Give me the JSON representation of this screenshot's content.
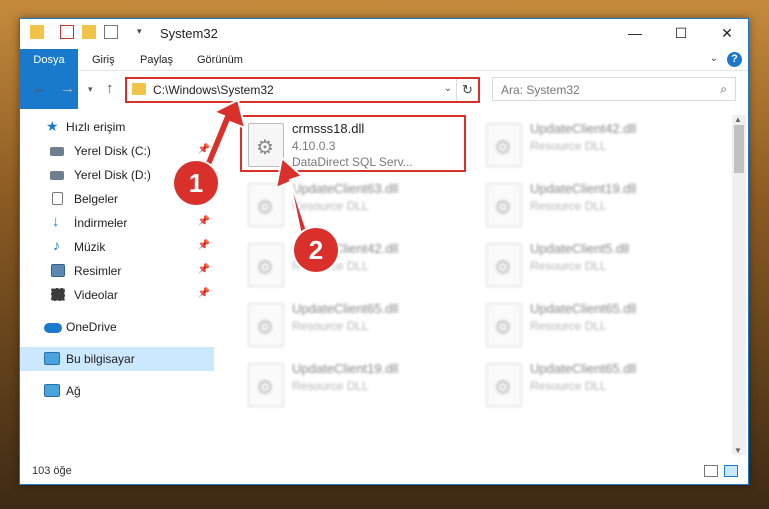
{
  "window": {
    "title": "System32",
    "controls": {
      "minimize": "—",
      "maximize": "☐",
      "close": "✕"
    }
  },
  "ribbon": {
    "tabs": [
      "Dosya",
      "Giriş",
      "Paylaş",
      "Görünüm"
    ],
    "help": "?"
  },
  "nav": {
    "address": "C:\\Windows\\System32",
    "search_placeholder": "Ara: System32"
  },
  "sidebar": {
    "items": [
      {
        "label": "Hızlı erişim",
        "icon": "star-icon"
      },
      {
        "label": "Yerel Disk (C:)",
        "icon": "drive-icon"
      },
      {
        "label": "Yerel Disk (D:)",
        "icon": "drive-icon"
      },
      {
        "label": "Belgeler",
        "icon": "documents-icon"
      },
      {
        "label": "İndirmeler",
        "icon": "download-icon"
      },
      {
        "label": "Müzik",
        "icon": "music-icon"
      },
      {
        "label": "Resimler",
        "icon": "pictures-icon"
      },
      {
        "label": "Videolar",
        "icon": "video-icon"
      },
      {
        "label": "OneDrive",
        "icon": "cloud-icon"
      },
      {
        "label": "Bu bilgisayar",
        "icon": "computer-icon"
      },
      {
        "label": "Ağ",
        "icon": "network-icon"
      }
    ]
  },
  "files": [
    {
      "name": "crmsss18.dll",
      "line2": "4.10.0.3",
      "line3": "DataDirect SQL Serv..."
    },
    {
      "name": "UpdateClient42.dll",
      "line2": "Resource DLL"
    },
    {
      "name": "UpdateClient63.dll",
      "line2": "Resource DLL"
    },
    {
      "name": "UpdateClient19.dll",
      "line2": "Resource DLL"
    },
    {
      "name": "UpdateClient42.dll",
      "line2": "Resource DLL"
    },
    {
      "name": "UpdateClient5.dll",
      "line2": "Resource DLL"
    },
    {
      "name": "UpdateClient65.dll",
      "line2": "Resource DLL"
    },
    {
      "name": "UpdateClient65.dll",
      "line2": "Resource DLL"
    },
    {
      "name": "UpdateClient19.dll",
      "line2": "Resource DLL"
    },
    {
      "name": "UpdateClient65.dll",
      "line2": "Resource DLL"
    }
  ],
  "status": {
    "count": "103 öğe"
  },
  "annotations": {
    "one": "1",
    "two": "2"
  },
  "colors": {
    "accent": "#1979ca",
    "highlight": "#d9302b",
    "selected": "#cce8ff"
  }
}
